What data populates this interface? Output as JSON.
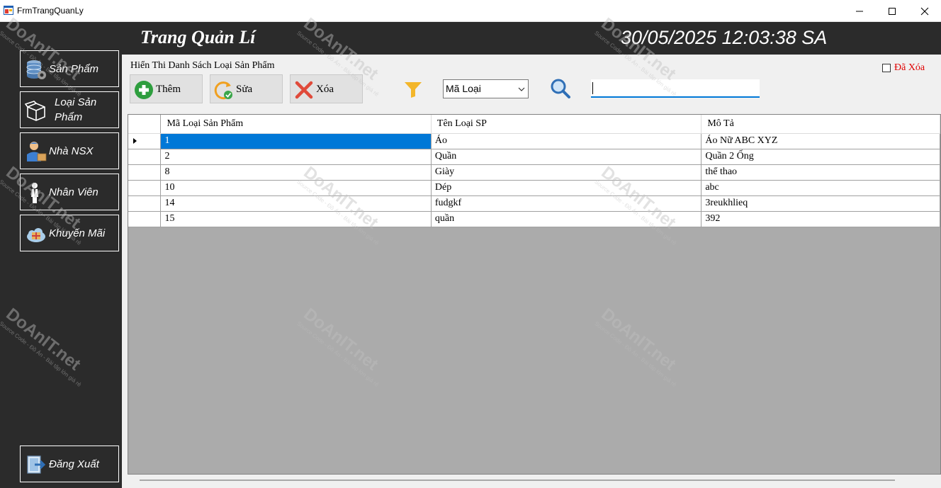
{
  "window": {
    "title": "FrmTrangQuanLy"
  },
  "header": {
    "title": "Trang Quản Lí",
    "clock": "30/05/2025 12:03:38 SA"
  },
  "sidebar": {
    "items": [
      {
        "label": "Sản Phẩm",
        "icon": "database-gear-icon"
      },
      {
        "label": "Loại Sản Phẩm",
        "icon": "box-icon"
      },
      {
        "label": "Nhà NSX",
        "icon": "delivery-man-icon"
      },
      {
        "label": "Nhân Viên",
        "icon": "employee-icon"
      },
      {
        "label": "Khuyến Mãi",
        "icon": "gift-cloud-icon"
      }
    ],
    "logout_label": "Đăng Xuất"
  },
  "main": {
    "list_caption": "Hiển Thi Danh Sách Loại Sản Phẩm",
    "toolbar": {
      "add_label": "Thêm",
      "edit_label": "Sửa",
      "delete_label": "Xóa"
    },
    "filter": {
      "selected": "Mã Loại",
      "search_value": ""
    },
    "deleted_checkbox_label": "Đã Xóa",
    "deleted_checked": false
  },
  "grid": {
    "columns": [
      "Mã Loại Sản Phẩm",
      "Tên Loại SP",
      "Mô Tả"
    ],
    "rows": [
      [
        "1",
        "Áo",
        "Áo Nữ ABC XYZ"
      ],
      [
        "2",
        "Quần",
        "Quần 2 Ống"
      ],
      [
        "8",
        "Giày",
        "thể thao"
      ],
      [
        "10",
        "Dép",
        "abc"
      ],
      [
        "14",
        "fudgkf",
        "3reukhlieq"
      ],
      [
        "15",
        "quần",
        "392"
      ]
    ],
    "selected_row": 0
  },
  "colors": {
    "sidebar_bg": "#2b2b2b",
    "selection": "#0078d7",
    "deleted_label": "#e00000",
    "grid_empty": "#ababab"
  },
  "watermark": {
    "brand": "DoAnIT.net",
    "tagline": "Source Code - Đồ Án - Bài tập lớn giá rẻ"
  }
}
